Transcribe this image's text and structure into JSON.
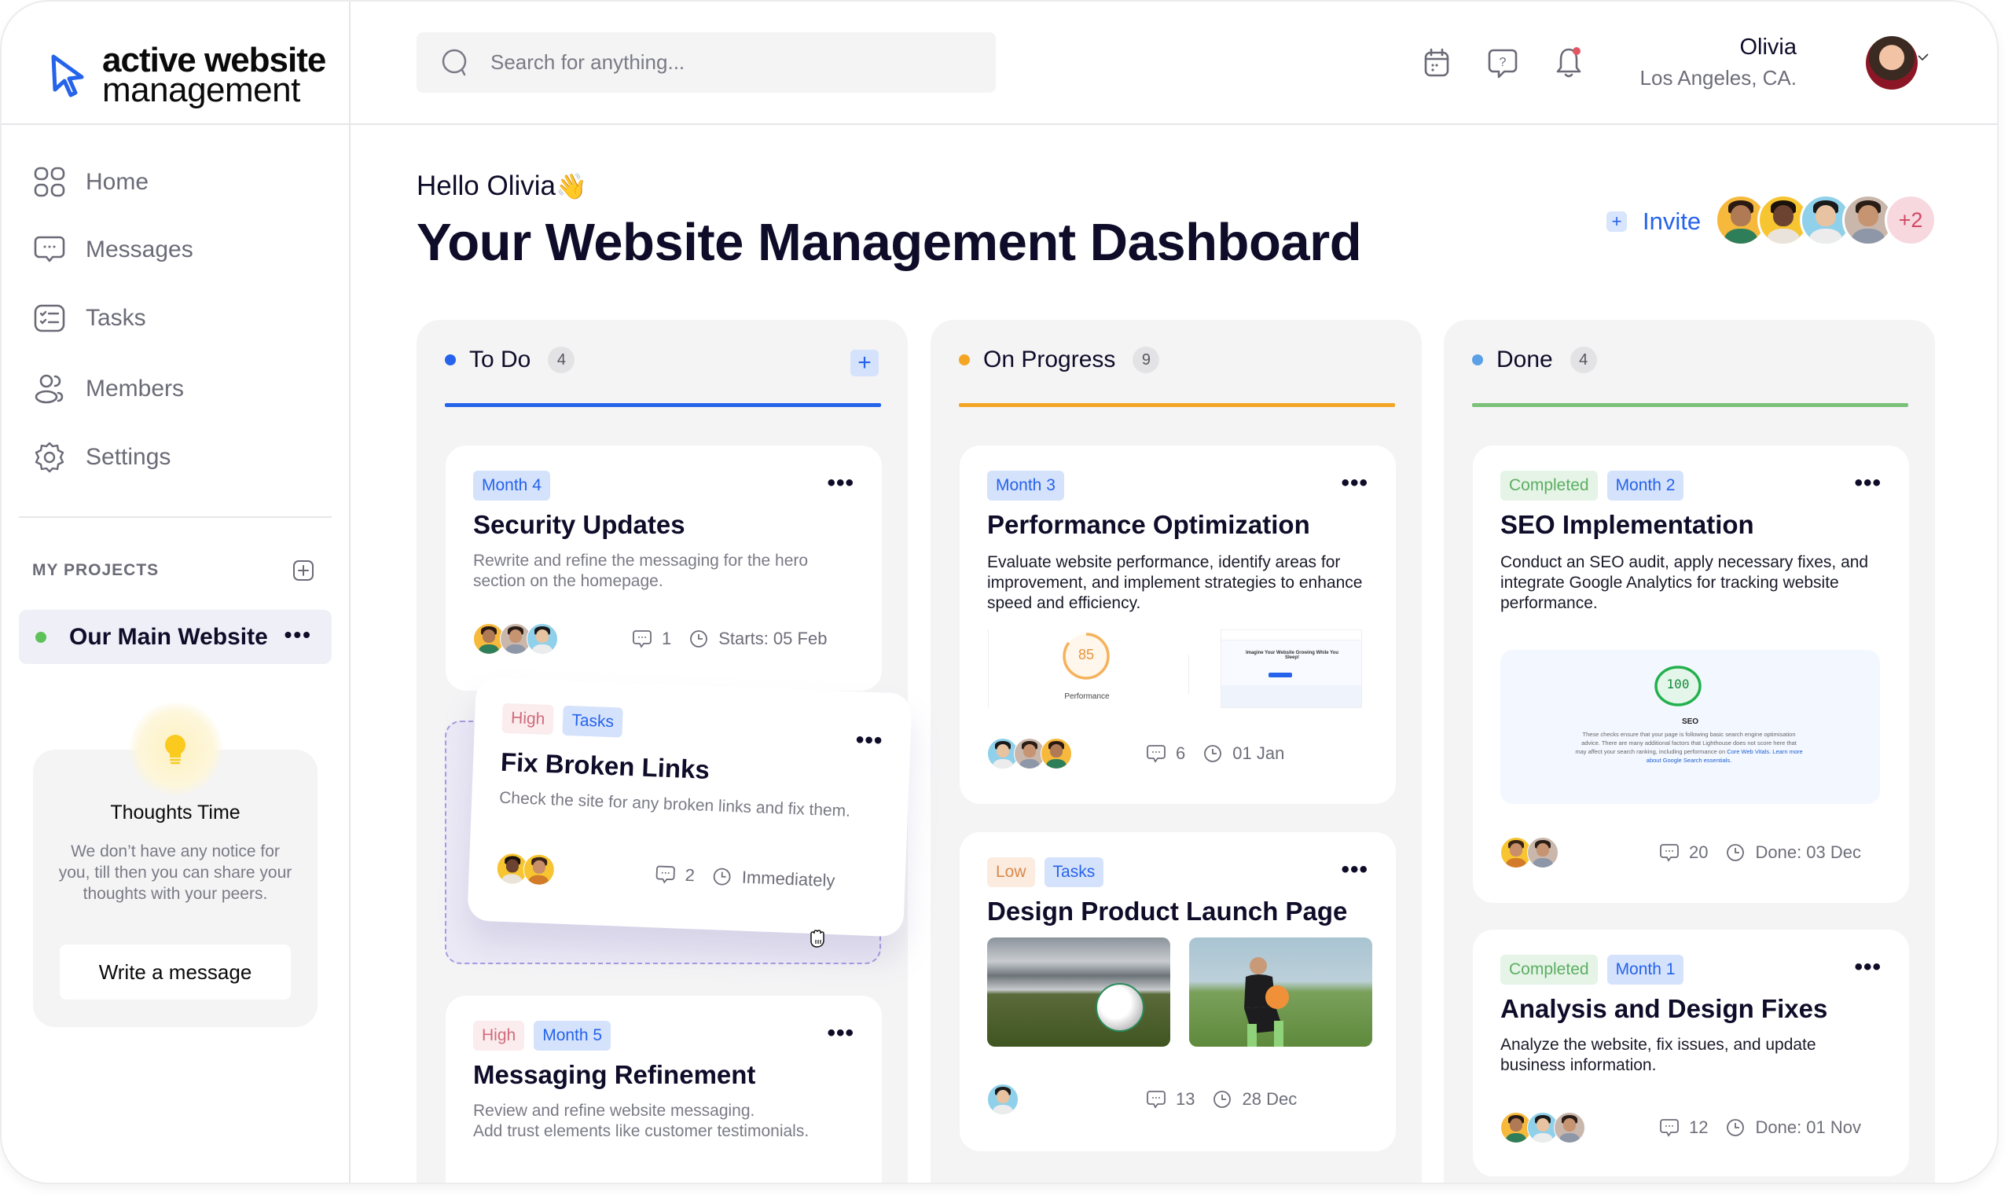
{
  "brand": {
    "line1": "active website",
    "line2": "management",
    "accent": "#2563eb"
  },
  "search": {
    "placeholder": "Search for anything..."
  },
  "header_icons": [
    "calendar-icon",
    "help-icon",
    "bell-icon"
  ],
  "user": {
    "name": "Olivia",
    "location": "Los Angeles, CA."
  },
  "sidebar": {
    "items": [
      {
        "label": "Home",
        "icon": "grid-icon"
      },
      {
        "label": "Messages",
        "icon": "chat-icon"
      },
      {
        "label": "Tasks",
        "icon": "checklist-icon"
      },
      {
        "label": "Members",
        "icon": "users-icon"
      },
      {
        "label": "Settings",
        "icon": "gear-icon"
      }
    ],
    "projects_title": "MY PROJECTS",
    "projects": [
      {
        "label": "Our Main Website",
        "status_color": "#5ec15a"
      }
    ],
    "thoughts": {
      "title": "Thoughts Time",
      "text": "We don’t have any notice for you, till then you can share your thoughts with your peers.",
      "button": "Write a message"
    }
  },
  "greeting": "Hello Olivia",
  "greeting_emoji": "👋",
  "page_title": "Your Website Management Dashboard",
  "invite": {
    "label": "Invite",
    "extra_members": "+2"
  },
  "columns": [
    {
      "name": "To Do",
      "count": "4",
      "color": "#2563eb",
      "cards": [
        {
          "tags": [
            {
              "label": "Month 4",
              "kind": "blue"
            }
          ],
          "title": "Security Updates",
          "desc": "Rewrite and refine the messaging for the hero section on the homepage.",
          "comments": "1",
          "date": "Starts: 05 Feb"
        },
        {
          "tags": [
            {
              "label": "High",
              "kind": "red"
            },
            {
              "label": "Tasks",
              "kind": "blue"
            }
          ],
          "title": "Fix Broken Links",
          "desc": "Check the site for any broken links and fix them.",
          "comments": "2",
          "date": "Immediately",
          "dragging": true
        },
        {
          "tags": [
            {
              "label": "High",
              "kind": "red"
            },
            {
              "label": "Month 5",
              "kind": "blue"
            }
          ],
          "title": "Messaging Refinement",
          "desc": "Review and refine website messaging.\nAdd trust elements like customer testimonials."
        }
      ]
    },
    {
      "name": "On Progress",
      "count": "9",
      "color": "#f5a524",
      "cards": [
        {
          "tags": [
            {
              "label": "Month 3",
              "kind": "blue"
            }
          ],
          "title": "Performance Optimization",
          "desc": "Evaluate website performance, identify areas for improvement, and implement strategies to enhance speed and efficiency.",
          "preview": {
            "score": "85",
            "label": "Performance",
            "site_heading": "Imagine Your Website Growing While You Sleep!"
          },
          "comments": "6",
          "date": "01 Jan"
        },
        {
          "tags": [
            {
              "label": "Low",
              "kind": "orange"
            },
            {
              "label": "Tasks",
              "kind": "blue"
            }
          ],
          "title": "Design Product Launch Page",
          "images": [
            "stadium-ball-photo",
            "player-with-ball-photo"
          ],
          "comments": "13",
          "date": "28 Dec"
        }
      ]
    },
    {
      "name": "Done",
      "count": "4",
      "color": "#5aa0e6",
      "line_color": "#7ac27a",
      "cards": [
        {
          "tags": [
            {
              "label": "Completed",
              "kind": "green"
            },
            {
              "label": "Month 2",
              "kind": "blue"
            }
          ],
          "title": "SEO Implementation",
          "desc": "Conduct an SEO audit, apply necessary fixes, and integrate Google Analytics for tracking website performance.",
          "preview": {
            "score": "100",
            "label": "SEO",
            "text": "These checks ensure that your page is following basic search engine optimisation advice. There are many additional factors that Lighthouse does not score here that may affect your search ranking, including performance on ",
            "link1": "Core Web Vitals.",
            "link2": " Learn more about Google Search essentials."
          },
          "comments": "20",
          "date": "Done: 03 Dec"
        },
        {
          "tags": [
            {
              "label": "Completed",
              "kind": "green"
            },
            {
              "label": "Month 1",
              "kind": "blue"
            }
          ],
          "title": "Analysis and Design Fixes",
          "desc": "Analyze the website, fix issues, and update business information.",
          "comments": "12",
          "date": "Done: 01 Nov"
        }
      ]
    }
  ]
}
